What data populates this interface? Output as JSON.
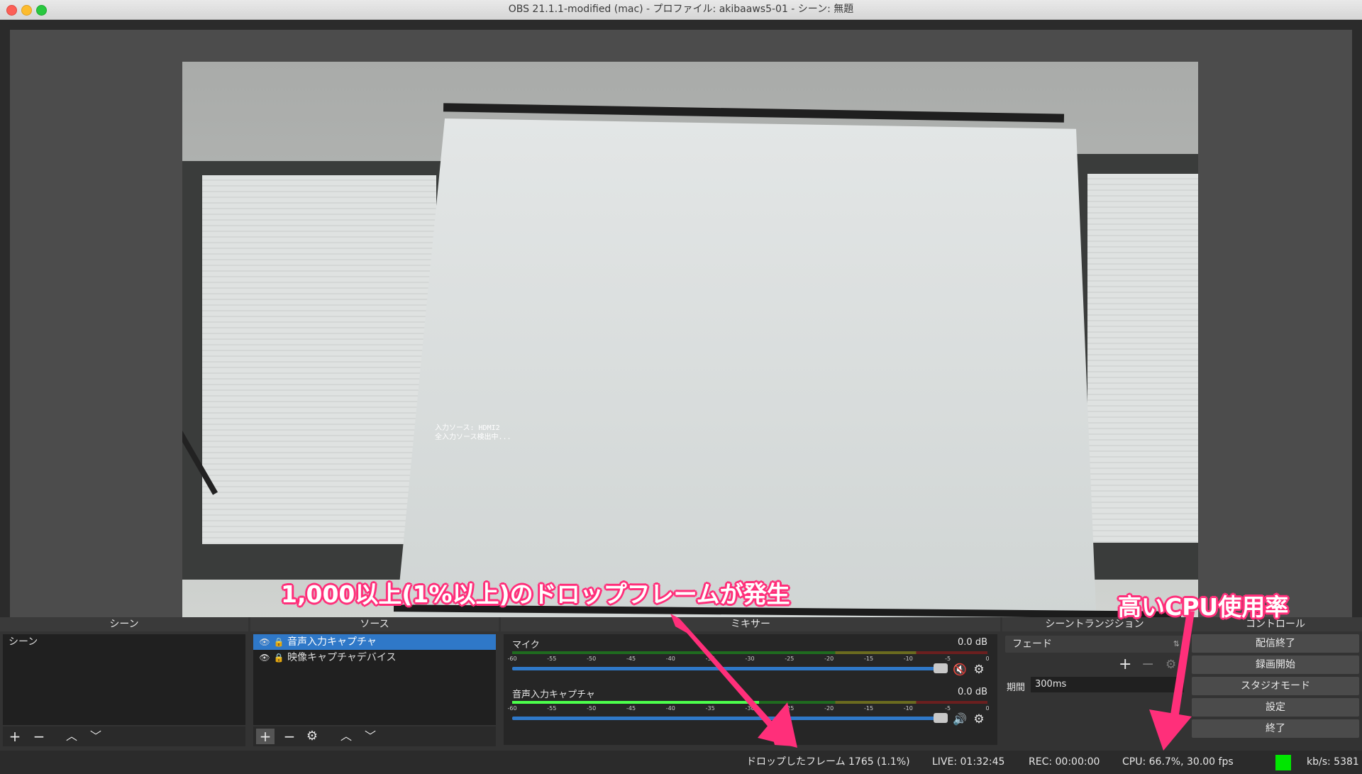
{
  "window": {
    "title": "OBS 21.1.1-modified (mac) - プロファイル: akibaaws5-01 - シーン: 無題"
  },
  "preview": {
    "osd_line1": "入力ソース: HDMI2",
    "osd_line2": "全入力ソース検出中..."
  },
  "docks": {
    "scenes": {
      "title": "シーン",
      "items": [
        "シーン"
      ]
    },
    "sources": {
      "title": "ソース",
      "items": [
        {
          "label": "音声入力キャプチャ",
          "visible": true,
          "locked": true,
          "selected": true
        },
        {
          "label": "映像キャプチャデバイス",
          "visible": true,
          "locked": true,
          "selected": false
        }
      ]
    },
    "mixer": {
      "title": "ミキサー",
      "ticks": [
        "-60",
        "-55",
        "-50",
        "-45",
        "-40",
        "-35",
        "-30",
        "-25",
        "-20",
        "-15",
        "-10",
        "-5",
        "0"
      ],
      "channels": [
        {
          "name": "マイク",
          "db": "0.0 dB",
          "muted": true,
          "level": 0.0
        },
        {
          "name": "音声入力キャプチャ",
          "db": "0.0 dB",
          "muted": false,
          "level": 0.52
        }
      ]
    },
    "transition": {
      "title": "シーントランジション",
      "selected": "フェード",
      "duration_label": "期間",
      "duration_value": "300ms"
    },
    "controls": {
      "title": "コントロール",
      "buttons": [
        "配信終了",
        "録画開始",
        "スタジオモード",
        "設定",
        "終了"
      ]
    }
  },
  "status": {
    "dropped_frames": "ドロップしたフレーム 1765 (1.1%)",
    "live": "LIVE: 01:32:45",
    "rec": "REC: 00:00:00",
    "cpu": "CPU: 66.7%, 30.00 fps",
    "kbps": "kb/s: 5381",
    "indicator_color": "#00e600"
  },
  "annotations": {
    "dropped": "1,000以上(1%以上)のドロップフレームが発生",
    "cpu": "高いCPU使用率",
    "color": "#ff2f7a"
  }
}
